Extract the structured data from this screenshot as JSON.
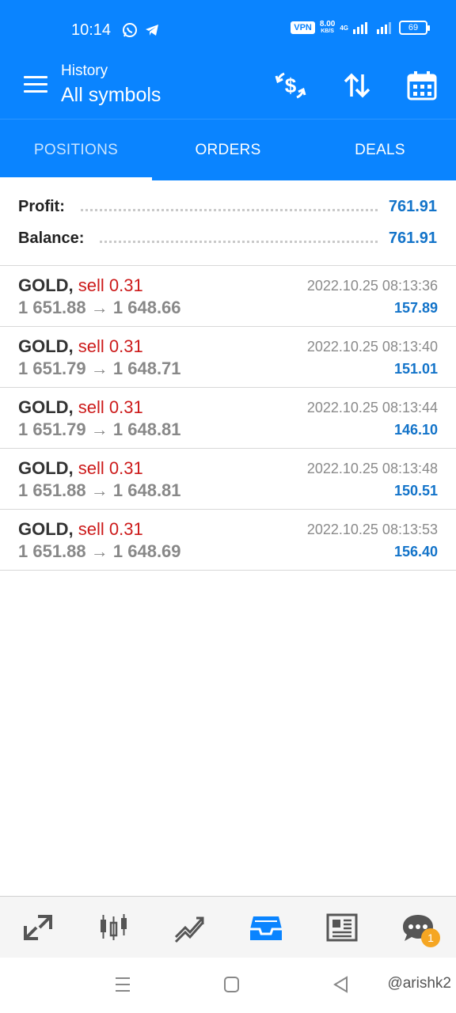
{
  "status_bar": {
    "time": "10:14",
    "vpn": "VPN",
    "net_speed_value": "8.00",
    "net_speed_unit": "KB/S",
    "network": "4G",
    "battery": "69"
  },
  "toolbar": {
    "subtitle": "History",
    "title": "All symbols"
  },
  "tabs": [
    {
      "label": "POSITIONS",
      "active": true
    },
    {
      "label": "ORDERS",
      "active": false
    },
    {
      "label": "DEALS",
      "active": false
    }
  ],
  "summary": {
    "profit_label": "Profit:",
    "profit_value": "761.91",
    "balance_label": "Balance:",
    "balance_value": "761.91"
  },
  "deals": [
    {
      "symbol": "GOLD,",
      "side": "sell 0.31",
      "open": "1 651.88",
      "arrow": "→",
      "close": "1 648.66",
      "time": "2022.10.25 08:13:36",
      "profit": "157.89"
    },
    {
      "symbol": "GOLD,",
      "side": "sell 0.31",
      "open": "1 651.79",
      "arrow": "→",
      "close": "1 648.71",
      "time": "2022.10.25 08:13:40",
      "profit": "151.01"
    },
    {
      "symbol": "GOLD,",
      "side": "sell 0.31",
      "open": "1 651.79",
      "arrow": "→",
      "close": "1 648.81",
      "time": "2022.10.25 08:13:44",
      "profit": "146.10"
    },
    {
      "symbol": "GOLD,",
      "side": "sell 0.31",
      "open": "1 651.88",
      "arrow": "→",
      "close": "1 648.81",
      "time": "2022.10.25 08:13:48",
      "profit": "150.51"
    },
    {
      "symbol": "GOLD,",
      "side": "sell 0.31",
      "open": "1 651.88",
      "arrow": "→",
      "close": "1 648.69",
      "time": "2022.10.25 08:13:53",
      "profit": "156.40"
    }
  ],
  "bottom_nav": {
    "items": [
      "quotes-icon",
      "chart-icon",
      "trade-icon",
      "history-icon",
      "news-icon",
      "messages-icon"
    ],
    "messages_badge": "1"
  },
  "watermark": "@arishk2",
  "colors": {
    "primary": "#0a84ff",
    "sell": "#cc1a1a",
    "profit": "#1273c9"
  }
}
